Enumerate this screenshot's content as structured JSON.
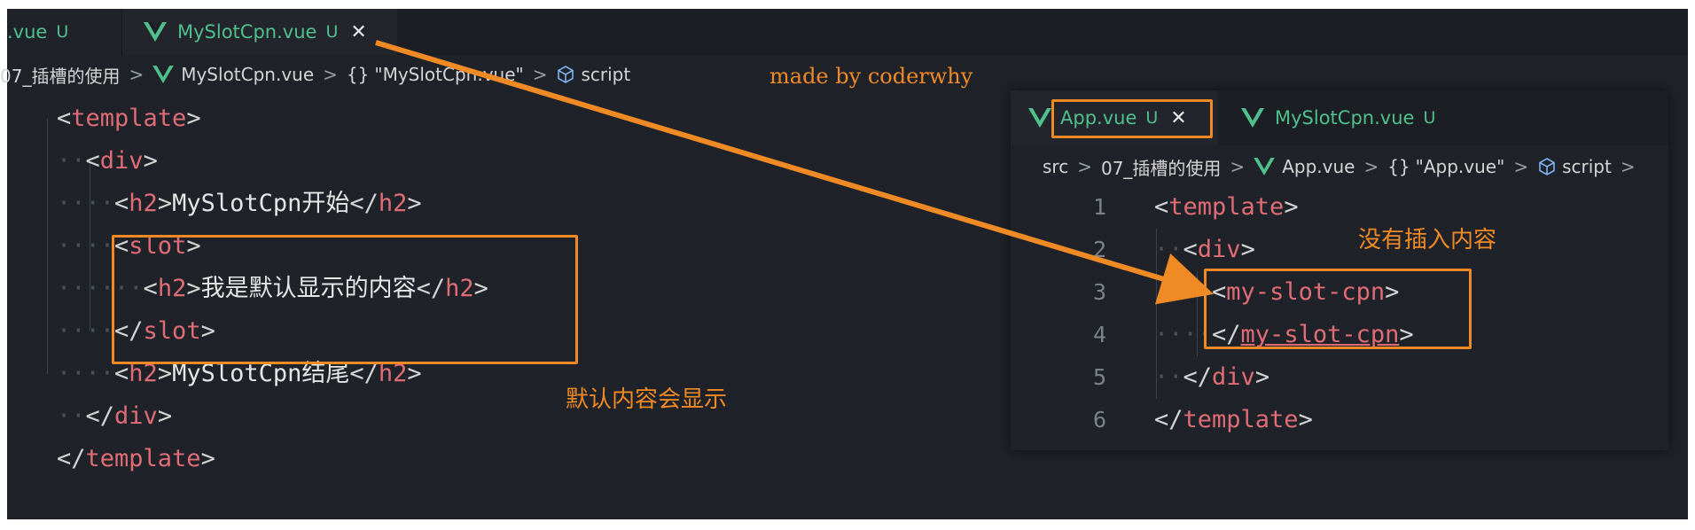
{
  "left": {
    "tabs": [
      {
        "label": ".vue",
        "modified": "U"
      },
      {
        "label": "MySlotCpn.vue",
        "modified": "U",
        "close": "✕"
      }
    ],
    "breadcrumb": {
      "folder": "07_插槽的使用",
      "file": "MySlotCpn.vue",
      "braces": "{}",
      "component": "\"MySlotCpn.vue\"",
      "section": "script",
      "sep": ">"
    },
    "code": [
      {
        "dots": "",
        "open": "<",
        "tag": "template",
        "close": ">",
        "text": "",
        "open2": "",
        "tag2": "",
        "close2": ""
      },
      {
        "dots": "··",
        "open": "<",
        "tag": "div",
        "close": ">",
        "text": "",
        "open2": "",
        "tag2": "",
        "close2": ""
      },
      {
        "dots": "····",
        "open": "<",
        "tag": "h2",
        "close": ">",
        "text": "MySlotCpn开始",
        "open2": "</",
        "tag2": "h2",
        "close2": ">"
      },
      {
        "dots": "····",
        "open": "<",
        "tag": "slot",
        "close": ">",
        "text": "",
        "open2": "",
        "tag2": "",
        "close2": ""
      },
      {
        "dots": "······",
        "open": "<",
        "tag": "h2",
        "close": ">",
        "text": "我是默认显示的内容",
        "open2": "</",
        "tag2": "h2",
        "close2": ">"
      },
      {
        "dots": "····",
        "open": "</",
        "tag": "slot",
        "close": ">",
        "text": "",
        "open2": "",
        "tag2": "",
        "close2": ""
      },
      {
        "dots": "····",
        "open": "<",
        "tag": "h2",
        "close": ">",
        "text": "MySlotCpn结尾",
        "open2": "</",
        "tag2": "h2",
        "close2": ">"
      },
      {
        "dots": "··",
        "open": "</",
        "tag": "div",
        "close": ">",
        "text": "",
        "open2": "",
        "tag2": "",
        "close2": ""
      },
      {
        "dots": "",
        "open": "</",
        "tag": "template",
        "close": ">",
        "text": "",
        "open2": "",
        "tag2": "",
        "close2": ""
      }
    ]
  },
  "right": {
    "tabs": [
      {
        "label": "App.vue",
        "modified": "U",
        "close": "✕"
      },
      {
        "label": "MySlotCpn.vue",
        "modified": "U"
      }
    ],
    "breadcrumb": {
      "root": "src",
      "folder": "07_插槽的使用",
      "file": "App.vue",
      "braces": "{}",
      "component": "\"App.vue\"",
      "section": "script",
      "sep": ">"
    },
    "line_numbers": [
      "1",
      "2",
      "3",
      "4",
      "5",
      "6"
    ],
    "code": [
      {
        "dots": "",
        "open": "<",
        "tag": "template",
        "close": ">"
      },
      {
        "dots": "··",
        "open": "<",
        "tag": "div",
        "close": ">"
      },
      {
        "dots": "····",
        "open": "<",
        "tag": "my-slot-cpn",
        "close": ">"
      },
      {
        "dots": "····",
        "open": "</",
        "tag": "my-slot-cpn",
        "close": ">"
      },
      {
        "dots": "··",
        "open": "</",
        "tag": "div",
        "close": ">"
      },
      {
        "dots": "",
        "open": "</",
        "tag": "template",
        "close": ">"
      }
    ]
  },
  "annotations": {
    "watermark": "made by coderwhy",
    "default_shown": "默认内容会显示",
    "no_content": "没有插入内容"
  },
  "colors": {
    "annotation": "#f08a24",
    "vue_green": "#4fc08d",
    "tag": "#e06c75",
    "editor_bg": "#1f2329"
  },
  "icons": [
    "vue-logo-icon",
    "close-icon",
    "cube-icon",
    "chevron-right-icon"
  ]
}
